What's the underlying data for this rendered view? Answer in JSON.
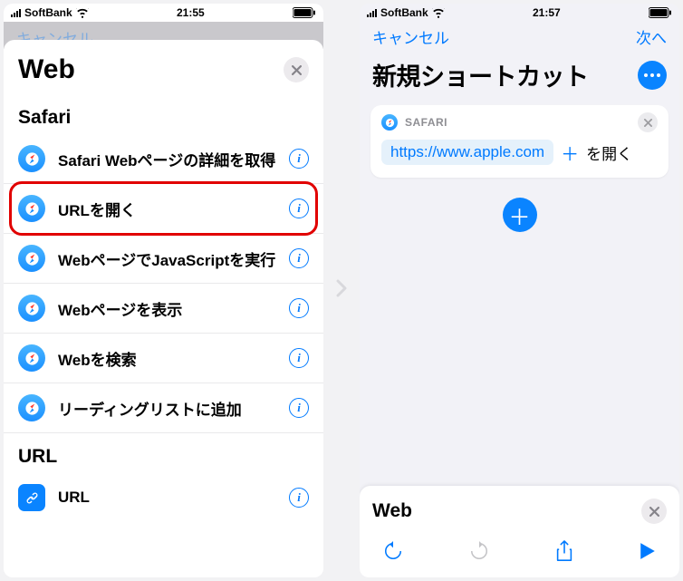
{
  "left": {
    "status": {
      "carrier": "SoftBank",
      "time": "21:55"
    },
    "back_cancel": "キャンセル",
    "sheet_title": "Web",
    "sections": [
      {
        "title": "Safari",
        "items": [
          {
            "name": "safari-web-detail",
            "label": "Safari Webページの詳細を取得"
          },
          {
            "name": "open-url",
            "label": "URLを開く",
            "highlighted": true
          },
          {
            "name": "run-js",
            "label": "WebページでJavaScriptを実行"
          },
          {
            "name": "show-page",
            "label": "Webページを表示"
          },
          {
            "name": "search-web",
            "label": "Webを検索"
          },
          {
            "name": "reading-list",
            "label": "リーディングリストに追加"
          }
        ]
      },
      {
        "title": "URL",
        "items": [
          {
            "name": "url-action",
            "label": "URL",
            "icon": "link"
          }
        ]
      }
    ]
  },
  "right": {
    "status": {
      "carrier": "SoftBank",
      "time": "21:57"
    },
    "nav": {
      "cancel": "キャンセル",
      "next": "次へ"
    },
    "title": "新規ショートカット",
    "card": {
      "app": "SAFARI",
      "url": "https://www.apple.com",
      "suffix": "を開く"
    },
    "bottom_title": "Web"
  }
}
